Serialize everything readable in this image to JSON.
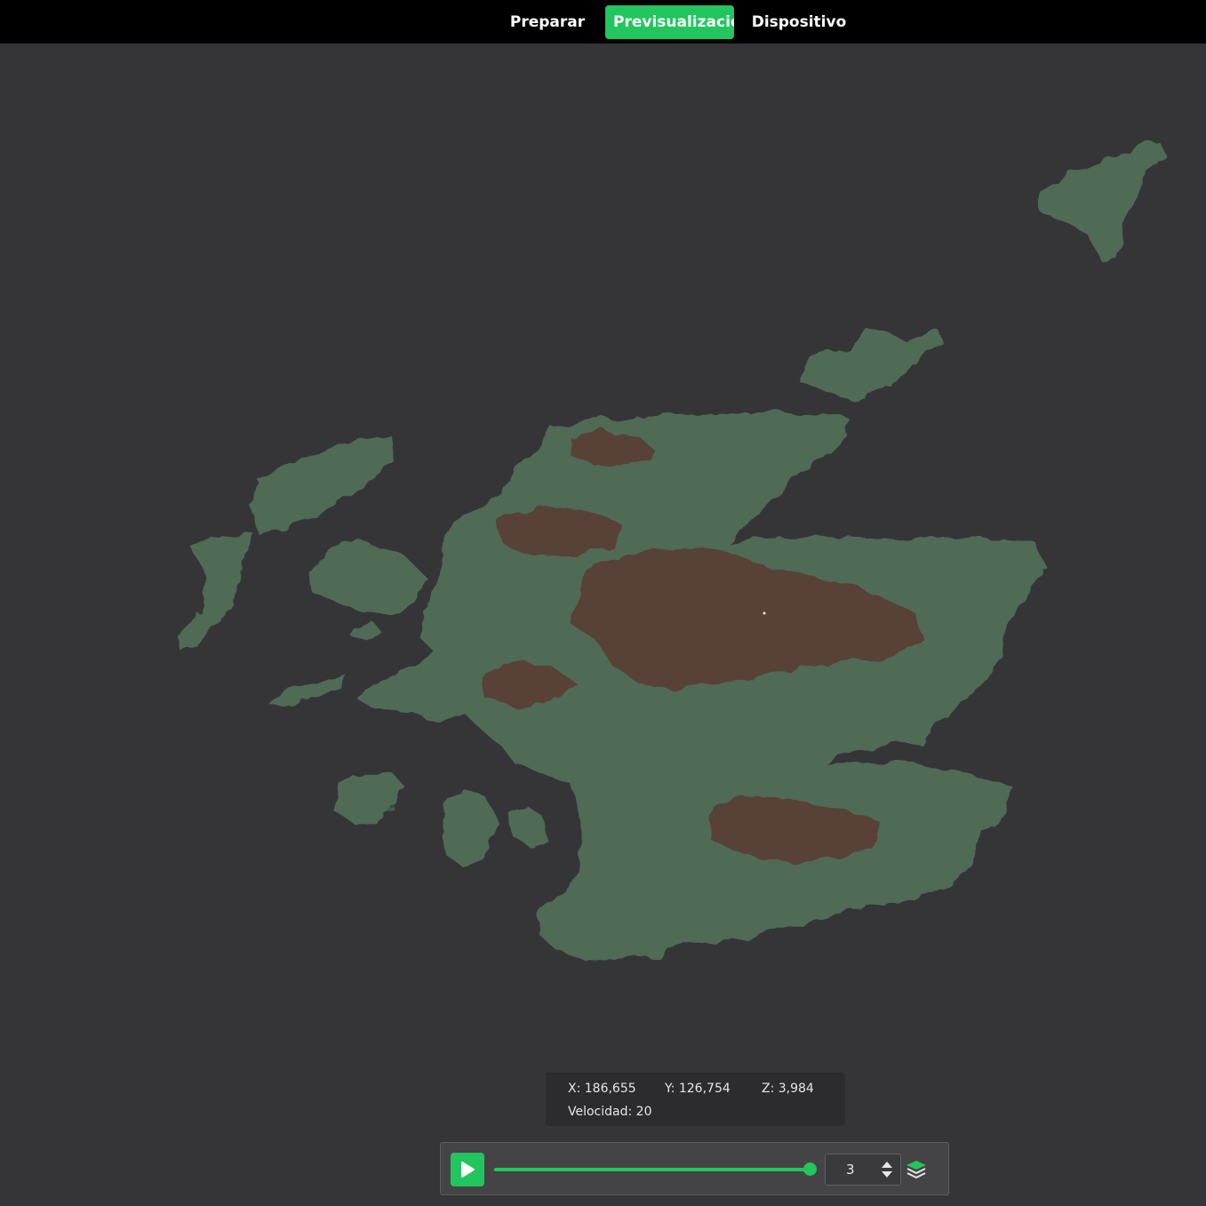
{
  "tabs": [
    {
      "label": "Preparar",
      "active": false
    },
    {
      "label": "Previsualización",
      "active": true
    },
    {
      "label": "Dispositivo",
      "active": false
    }
  ],
  "viewport": {
    "content": "terrain-3d-model",
    "icons": [
      "play-icon",
      "stepper-up-icon",
      "stepper-down-icon",
      "layers-icon"
    ]
  },
  "coords": {
    "x": "X: 186,655",
    "y": "Y: 126,754",
    "z": "Z: 3,984",
    "speed": "Velocidad: 20"
  },
  "controls": {
    "progress": 1.0,
    "layer_value": "3"
  },
  "colors": {
    "accent": "#22c55e",
    "background": "#353538",
    "topbar": "#000000",
    "terrain_low": "#4f6a55",
    "terrain_high": "#5a3a32"
  }
}
